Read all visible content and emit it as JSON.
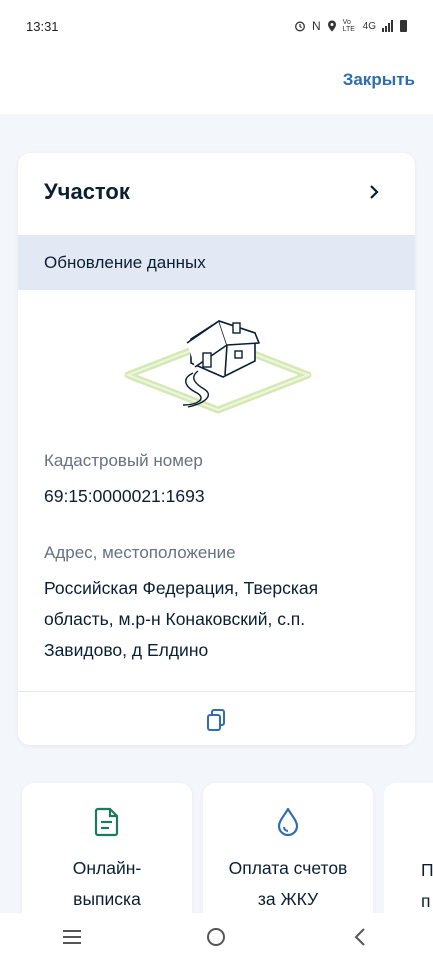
{
  "status_bar": {
    "time": "13:31",
    "icons": [
      "alarm-icon",
      "nfc-icon",
      "location-icon",
      "volte-icon",
      "4g-icon",
      "signal-icon",
      "battery-icon"
    ],
    "nfc": "N",
    "volte": "Vo LTE",
    "network": "4G"
  },
  "header": {
    "close_label": "Закрыть"
  },
  "card": {
    "title": "Участок",
    "update_label": "Обновление данных",
    "cadastral_label": "Кадастровый номер",
    "cadastral_value": "69:15:0000021:1693",
    "address_label": "Адрес, местоположение",
    "address_value": "Российская Федерация, Тверская область, м.р-н Конаковский, с.п. Завидово, д Елдино"
  },
  "services": [
    {
      "label_line1": "Онлайн-",
      "label_line2": "выписка",
      "icon": "document-icon"
    },
    {
      "label_line1": "Оплата счетов",
      "label_line2": "за ЖКУ",
      "icon": "water-drop-icon"
    },
    {
      "label_line1": "П",
      "label_line2": "п"
    }
  ],
  "colors": {
    "accent": "#2e6db4",
    "icon_green": "#1b7a5e",
    "update_bg": "#e3e9f4",
    "page_bg": "#f3f6fb"
  }
}
